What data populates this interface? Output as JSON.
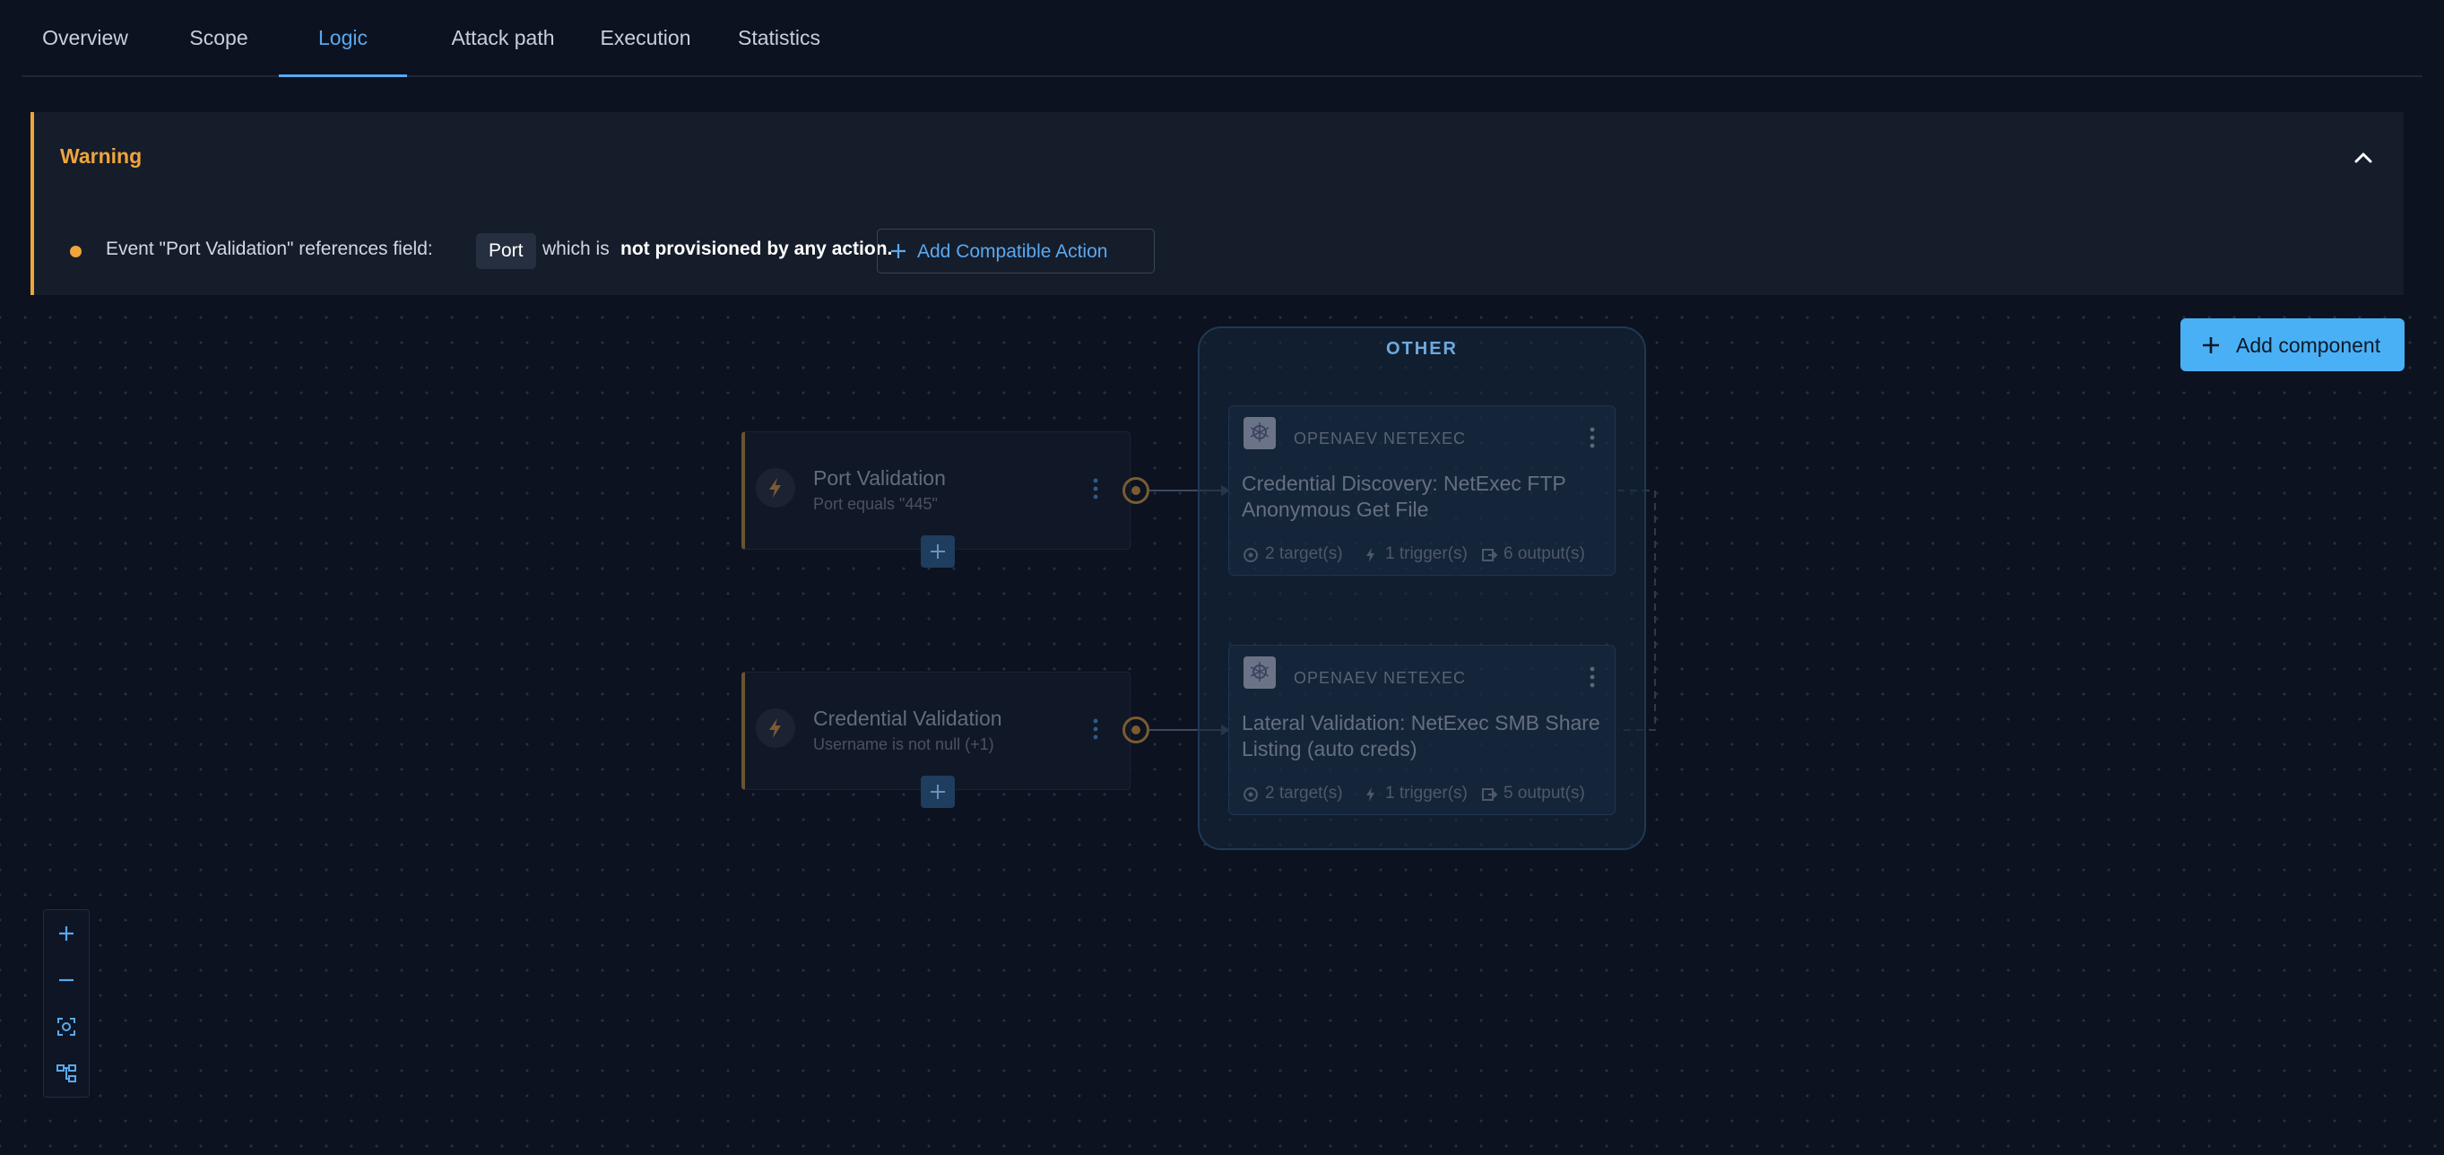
{
  "tabs": [
    {
      "label": "Overview"
    },
    {
      "label": "Scope"
    },
    {
      "label": "Logic"
    },
    {
      "label": "Attack path"
    },
    {
      "label": "Execution"
    },
    {
      "label": "Statistics"
    }
  ],
  "active_tab": "Logic",
  "warning": {
    "title": "Warning",
    "message_prefix": "Event \"Port Validation\" references field:",
    "field_chip": "Port",
    "message_middle": "which is",
    "message_strong": "not provisioned by any action.",
    "action_label": "Add Compatible Action",
    "accent_color": "#f0a43a"
  },
  "toolbar": {
    "add_component_label": "Add component"
  },
  "group": {
    "label": "OTHER"
  },
  "triggers": [
    {
      "title": "Port Validation",
      "subtitle": "Port equals \"445\""
    },
    {
      "title": "Credential Validation",
      "subtitle": "Username is not null (+1)"
    }
  ],
  "actions": [
    {
      "provider": "OPENAEV NETEXEC",
      "title": "Credential Discovery: NetExec FTP Anonymous Get File",
      "targets": "2 target(s)",
      "triggers": "1 trigger(s)",
      "outputs": "6 output(s)"
    },
    {
      "provider": "OPENAEV NETEXEC",
      "title": "Lateral Validation: NetExec SMB Share Listing (auto creds)",
      "targets": "2 target(s)",
      "triggers": "1 trigger(s)",
      "outputs": "5 output(s)"
    }
  ],
  "controls": {
    "icons": [
      "plus-icon",
      "minus-icon",
      "fit-view-icon",
      "auto-layout-icon"
    ]
  },
  "colors": {
    "accent": "#5aa9f0",
    "primary_button": "#4ab0f5",
    "background": "#0c1220"
  }
}
